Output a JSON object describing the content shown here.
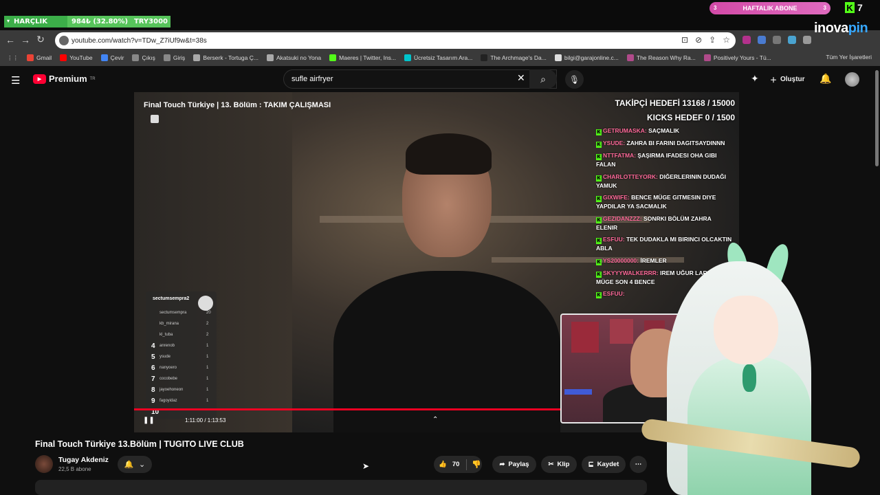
{
  "overlay": {
    "harclik_label": "HARÇLIK",
    "harclik_amount": "984₺ (32.80%)",
    "harclik_goal": "TRY3000",
    "haftalik_label": "HAFTALIK ABONE",
    "haftalik_left": "3",
    "haftalik_right": "3",
    "kick_count": "7",
    "kick_logo": "K",
    "sponsor_main": "inova",
    "sponsor_accent": "pin"
  },
  "browser": {
    "url": "youtube.com/watch?v=TDw_Z7iUf9w&t=38s",
    "bookmarks": [
      {
        "label": "Gmail",
        "color": "#ea4335"
      },
      {
        "label": "YouTube",
        "color": "#ff0000"
      },
      {
        "label": "Çevir",
        "color": "#4285f4"
      },
      {
        "label": "Çıkış",
        "color": "#888888"
      },
      {
        "label": "Giriş",
        "color": "#888888"
      },
      {
        "label": "Berserk - Tortuga Ç...",
        "color": "#aaaaaa"
      },
      {
        "label": "Akatsuki no Yona",
        "color": "#aaaaaa"
      },
      {
        "label": "Maeres | Twitter, Ins...",
        "color": "#53fc18"
      },
      {
        "label": "Ücretsiz Tasarım Ara...",
        "color": "#00c4cc"
      },
      {
        "label": "The Archmage's Da...",
        "color": "#222222"
      },
      {
        "label": "bilgi@garajonline.c...",
        "color": "#dddddd"
      },
      {
        "label": "The Reason Why Ra...",
        "color": "#b04a8a"
      },
      {
        "label": "Positively Yours - Tü...",
        "color": "#b04a8a"
      }
    ],
    "all_bookmarks": "Tüm Yer İşaretleri"
  },
  "youtube": {
    "logo": "Premium",
    "logo_sup": "TR",
    "search_value": "sufle airfryer",
    "create_label": "Oluştur"
  },
  "video": {
    "overlay_title": "Final Touch Türkiye | 13. Bölüm : TAKIM ÇALIŞMASI",
    "takipci": "TAKİPÇİ HEDEFİ 13168 / 15000",
    "kicks": "KICKS HEDEF 0 / 1500",
    "chat": [
      {
        "user": "GETRUMASKA:",
        "text": "SAÇMALIK"
      },
      {
        "user": "YSUDE:",
        "text": "ZAHRA BI FARINI DAGITSAYDINNN"
      },
      {
        "user": "NTTFATMA:",
        "text": "ŞAŞIRMA IFADESI OHA GIBI FALAN"
      },
      {
        "user": "CHARLOTTEYORK:",
        "text": "DIĞERLERININ DUDAĞI YAMUK"
      },
      {
        "user": "GIXWIFE:",
        "text": "BENCE MÜGE GITMESIN DIYE YAPDILAR YA SACMALIK"
      },
      {
        "user": "GEZIDANZZZ:",
        "text": "SONRKI BÖLÜM ZAHRA ELENIR"
      },
      {
        "user": "ESFUU:",
        "text": "TEK DUDAKLA MI BIRINCI OLCAKTIN ABLA"
      },
      {
        "user": "YS20000000:",
        "text": "İREMLER"
      },
      {
        "user": "SKYYYWALKERRR:",
        "text": "IREM UĞUR LARINA MÜGE SON 4 BENCE"
      },
      {
        "user": "ESFUU:",
        "text": ""
      }
    ],
    "leaderboard": {
      "title": "sectumsempra2",
      "rows": [
        {
          "rank": "",
          "name": "sectumsempra",
          "score": "20"
        },
        {
          "rank": "",
          "name": "kb_mirana",
          "score": "2"
        },
        {
          "rank": "",
          "name": "kl_tuba",
          "score": "2"
        },
        {
          "rank": "4",
          "name": "anrenob",
          "score": "1"
        },
        {
          "rank": "5",
          "name": "ysude",
          "score": "1"
        },
        {
          "rank": "6",
          "name": "nanyoero",
          "score": "1"
        },
        {
          "rank": "7",
          "name": "cocobebe",
          "score": "1"
        },
        {
          "rank": "8",
          "name": "jayoehoneon",
          "score": "1"
        },
        {
          "rank": "9",
          "name": "fagoyidaz",
          "score": "1"
        },
        {
          "rank": "10",
          "name": "",
          "score": ""
        }
      ]
    },
    "time": "1:11:00 / 1:13:53",
    "progress": 1.0
  },
  "below": {
    "title": "Final Touch Türkiye 13.Bölüm | TUGITO LIVE CLUB",
    "channel": "Tugay Akdeniz",
    "subscribers": "22,5 B abone",
    "likes": "70",
    "share": "Paylaş",
    "clip": "Klip",
    "save": "Kaydet"
  }
}
